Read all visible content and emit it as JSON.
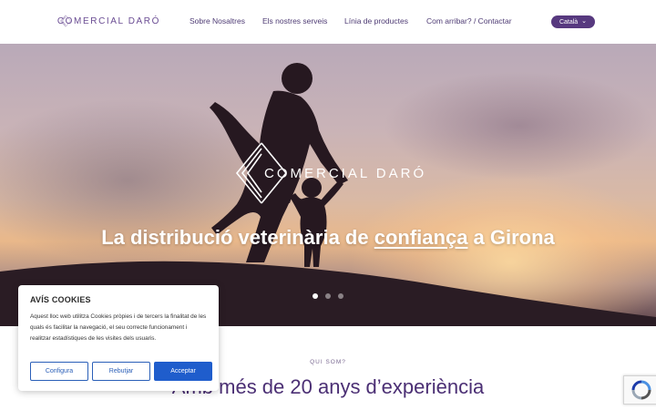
{
  "header": {
    "logo_text": "COMERCIAL DARÓ",
    "nav": [
      {
        "label": "Sobre Nosaltres"
      },
      {
        "label": "Els nostres serveis"
      },
      {
        "label": "Línia de productes"
      },
      {
        "label": "Com arribar? / Contactar"
      }
    ],
    "language": "Català"
  },
  "hero": {
    "logo_text": "COMERCIAL DARÓ",
    "title_before": "La distribució veterinària de ",
    "title_highlight": "confiança",
    "title_after": " a Girona",
    "slides": 3,
    "active_slide": 1
  },
  "section": {
    "eyebrow": "QUI SOM?",
    "title": "Amb més de 20 anys d’experiència"
  },
  "cookie": {
    "title": "AVÍS COOKIES",
    "text": "Aquest lloc web utilitza Cookies pròpies i de tercers la finalitat de les quals és facilitar la navegació, el seu correcte funcionament i realitzar estadístiques de les visites dels usuaris.",
    "configure": "Configura",
    "reject": "Rebutjar",
    "accept": "Acceptar"
  },
  "colors": {
    "brand_purple": "#57397f",
    "accept_blue": "#1f5dcc"
  }
}
